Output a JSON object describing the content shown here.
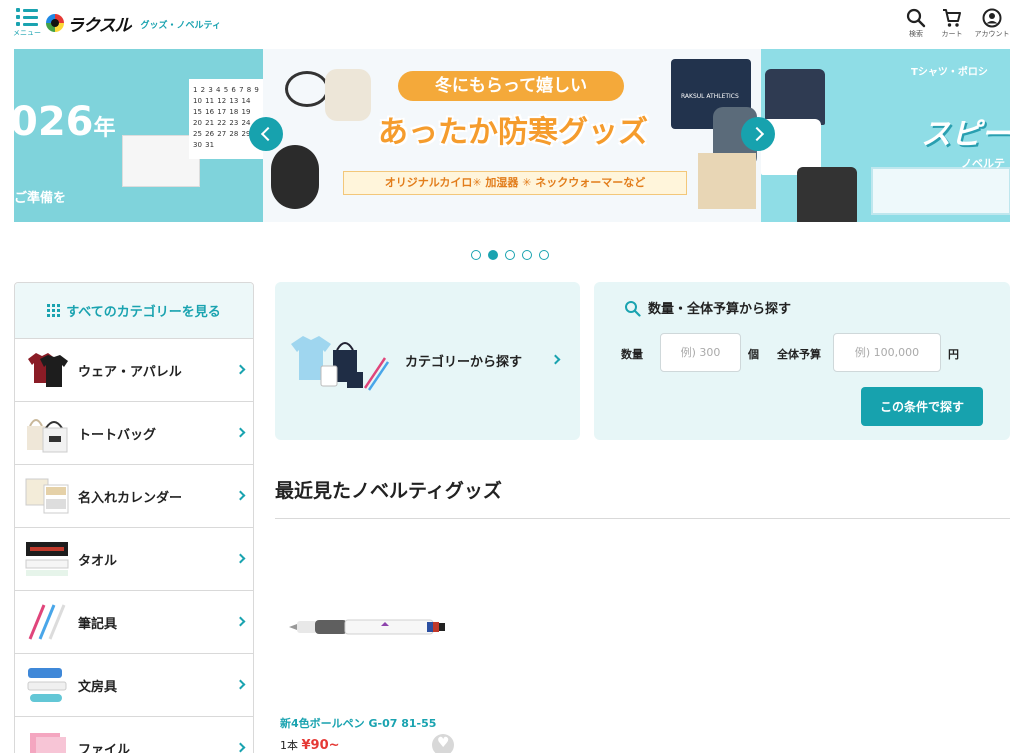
{
  "header": {
    "menu_label": "メニュー",
    "logo_text": "ラクスル",
    "logo_sub": "グッズ・ノベルティ",
    "search_label": "検索",
    "cart_label": "カート",
    "account_label": "アカウント"
  },
  "banner": {
    "left": {
      "year": "026",
      "year_suffix": "年",
      "prep": "ご準備を",
      "calendar": "1 2 3 4 5 6 7 8 9 10 11 12 13 14 15 16 17 18 19 20 21 22 23 24 25 26 27 28 29 30 31"
    },
    "center": {
      "bubble": "冬にもらって嬉しい",
      "title": "あったか防寒グッズ",
      "strip": "オリジナルカイロ✳ 加湿器 ✳ ネックウォーマーなど",
      "bag_text": "RAKSUL ATHLETICS"
    },
    "right": {
      "text1": "Tシャツ・ポロシ",
      "text2": "スピード",
      "text3": "ノベルテ"
    },
    "slide_count": 5,
    "active_slide": 2
  },
  "sidebar": {
    "all_categories": "すべてのカテゴリーを見る",
    "items": [
      {
        "label": "ウェア・アパレル",
        "icon": "tshirt-icon"
      },
      {
        "label": "トートバッグ",
        "icon": "tote-bag-icon"
      },
      {
        "label": "名入れカレンダー",
        "icon": "calendar-icon"
      },
      {
        "label": "タオル",
        "icon": "towel-icon"
      },
      {
        "label": "筆記具",
        "icon": "pen-icon"
      },
      {
        "label": "文房具",
        "icon": "stationery-icon"
      },
      {
        "label": "ファイル",
        "icon": "file-icon"
      }
    ]
  },
  "category_panel": {
    "label": "カテゴリーから探す"
  },
  "search_panel": {
    "title": "数量・全体予算から探す",
    "qty_label": "数量",
    "qty_placeholder": "例) 300",
    "qty_unit": "個",
    "budget_label": "全体予算",
    "budget_placeholder": "例) 100,000",
    "budget_unit": "円",
    "submit_label": "この条件で探す"
  },
  "recent": {
    "title": "最近見たノベルティグッズ",
    "products": [
      {
        "name": "新4色ボールペン G-07 81-55",
        "unit": "1本",
        "price": "¥90~"
      }
    ]
  },
  "colors": {
    "accent": "#17a2ae",
    "panel_bg": "#e7f6f7",
    "price_red": "#e53935",
    "banner_orange": "#f59c2d"
  }
}
